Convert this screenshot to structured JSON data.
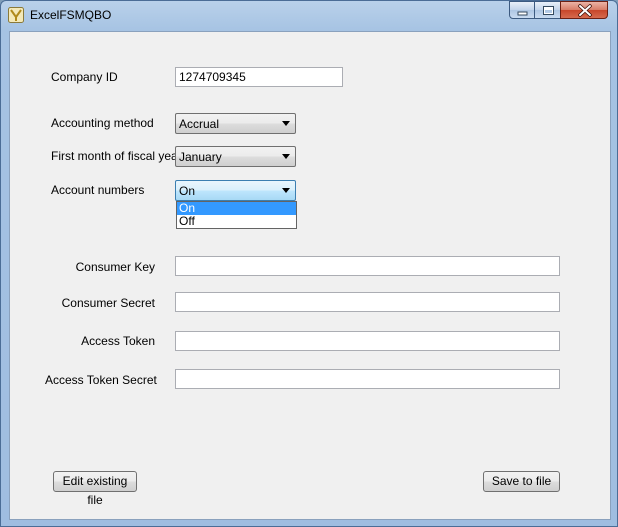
{
  "window": {
    "title": "ExcelFSMQBO"
  },
  "form": {
    "company_id": {
      "label": "Company ID",
      "value": "1274709345"
    },
    "accounting_method": {
      "label": "Accounting method",
      "value": "Accrual"
    },
    "fiscal_month": {
      "label": "First month of fiscal year",
      "value": "January"
    },
    "account_numbers": {
      "label": "Account numbers",
      "value": "On",
      "options": [
        "On",
        "Off"
      ]
    },
    "consumer_key": {
      "label": "Consumer Key",
      "value": ""
    },
    "consumer_secret": {
      "label": "Consumer Secret",
      "value": ""
    },
    "access_token": {
      "label": "Access Token",
      "value": ""
    },
    "access_token_secret": {
      "label": "Access Token Secret",
      "value": ""
    }
  },
  "buttons": {
    "edit_existing": "Edit existing file",
    "save_to_file": "Save to file"
  },
  "icons": {
    "app": "app-icon",
    "minimize": "minimize-icon",
    "maximize": "maximize-icon",
    "close": "close-icon",
    "dropdown": "chevron-down-icon"
  },
  "colors": {
    "selection": "#3399ff",
    "client_bg": "#f0f0f0",
    "close_button": "#c7462a"
  }
}
